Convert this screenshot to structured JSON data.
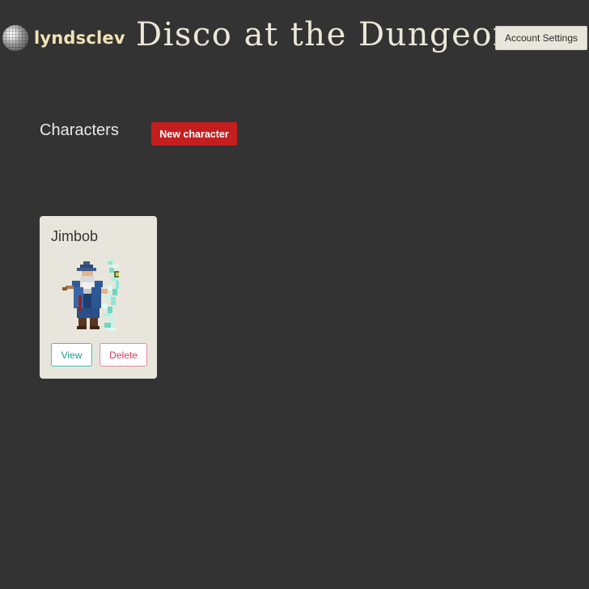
{
  "header": {
    "username": "lyndsclev",
    "site_title": "Disco at the Dungeon",
    "account_settings_label": "Account Settings"
  },
  "characters": {
    "heading": "Characters",
    "new_character_label": "New character",
    "items": [
      {
        "name": "Jimbob",
        "view_label": "View",
        "delete_label": "Delete"
      }
    ]
  },
  "colors": {
    "background": "#333333",
    "username": "#f2e3b3",
    "new_character_button": "#c41e1e",
    "card_background": "#e8e6dc",
    "view_accent": "#179e8e",
    "delete_accent": "#d43a5a"
  }
}
